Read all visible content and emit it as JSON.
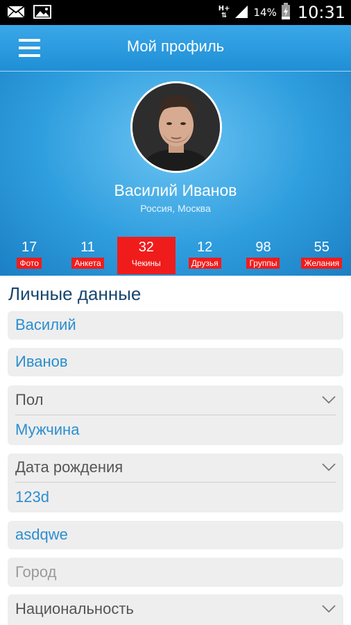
{
  "status_bar": {
    "network": "H+",
    "battery_percent": "14%",
    "time": "10:31"
  },
  "app_bar": {
    "title": "Мой профиль"
  },
  "profile": {
    "name": "Василий Иванов",
    "location": "Россия, Москва"
  },
  "stats": [
    {
      "count": "17",
      "label": "Фото",
      "active": false
    },
    {
      "count": "11",
      "label": "Анкета",
      "active": false
    },
    {
      "count": "32",
      "label": "Чекины",
      "active": true
    },
    {
      "count": "12",
      "label": "Друзья",
      "active": false
    },
    {
      "count": "98",
      "label": "Группы",
      "active": false
    },
    {
      "count": "55",
      "label": "Желания",
      "active": false
    }
  ],
  "personal": {
    "section_title": "Личные данные",
    "first_name": "Василий",
    "last_name": "Иванов",
    "gender_label": "Пол",
    "gender_value": "Мужчина",
    "birthdate_label": "Дата рождения",
    "birthdate_value": "123d",
    "extra_value": "asdqwe",
    "city_placeholder": "Город",
    "nationality_label": "Национальность"
  },
  "colors": {
    "accent": "#1f8fd6",
    "active_stat": "#f01c1c",
    "field_value": "#2b8ecf",
    "section_title": "#17466e"
  },
  "icons": [
    "mail-icon",
    "image-icon",
    "signal-icon",
    "battery-icon",
    "menu-icon",
    "chevron-down-icon"
  ]
}
